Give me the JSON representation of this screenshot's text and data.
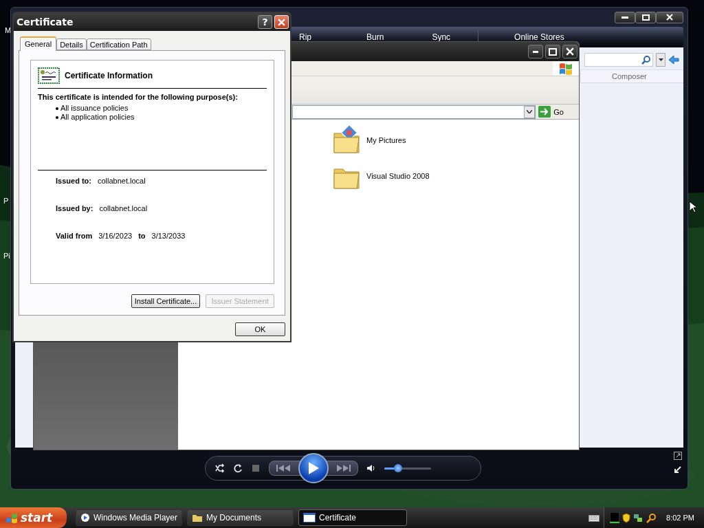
{
  "desktop": {
    "icon_labels": [
      "M",
      "P",
      "Pi"
    ]
  },
  "media_player": {
    "tabs": [
      {
        "label": "Rip",
        "selected": false
      },
      {
        "label": "Burn",
        "selected": false
      },
      {
        "label": "Sync",
        "selected": false
      },
      {
        "label": "Online Stores",
        "selected": false
      }
    ],
    "columns": [
      "Composer"
    ],
    "volume": {
      "level": 0.3
    }
  },
  "explorer": {
    "go_button": "Go",
    "items": [
      {
        "label": "My Pictures",
        "kind": "pictures"
      },
      {
        "label": "Visual Studio 2008",
        "kind": "folder"
      }
    ]
  },
  "dialog": {
    "title": "Certificate",
    "help": "?",
    "tabs": [
      {
        "label": "General",
        "selected": true
      },
      {
        "label": "Details",
        "selected": false
      },
      {
        "label": "Certification Path",
        "selected": false
      }
    ],
    "heading": "Certificate Information",
    "purpose_title": "This certificate is intended for the following purpose(s):",
    "purposes": [
      "All issuance policies",
      "All application policies"
    ],
    "fields": [
      {
        "label": "Issued to:",
        "value": "collabnet.local"
      },
      {
        "label": "Issued by:",
        "value": "collabnet.local"
      }
    ],
    "valid": {
      "label": "Valid from",
      "from": "3/16/2023",
      "to_label": "to",
      "to": "3/13/2033"
    },
    "buttons": [
      {
        "label": "Install Certificate...",
        "disabled": false
      },
      {
        "label": "Issuer Statement",
        "disabled": true
      }
    ],
    "ok": "OK"
  },
  "taskbar": {
    "start": "start",
    "tasks": [
      {
        "label": "Windows Media Player",
        "kind": "media",
        "selected": false
      },
      {
        "label": "My Documents",
        "kind": "folder",
        "selected": false
      },
      {
        "label": "Certificate",
        "kind": "window",
        "selected": true
      }
    ],
    "clock": "8:02 PM"
  }
}
